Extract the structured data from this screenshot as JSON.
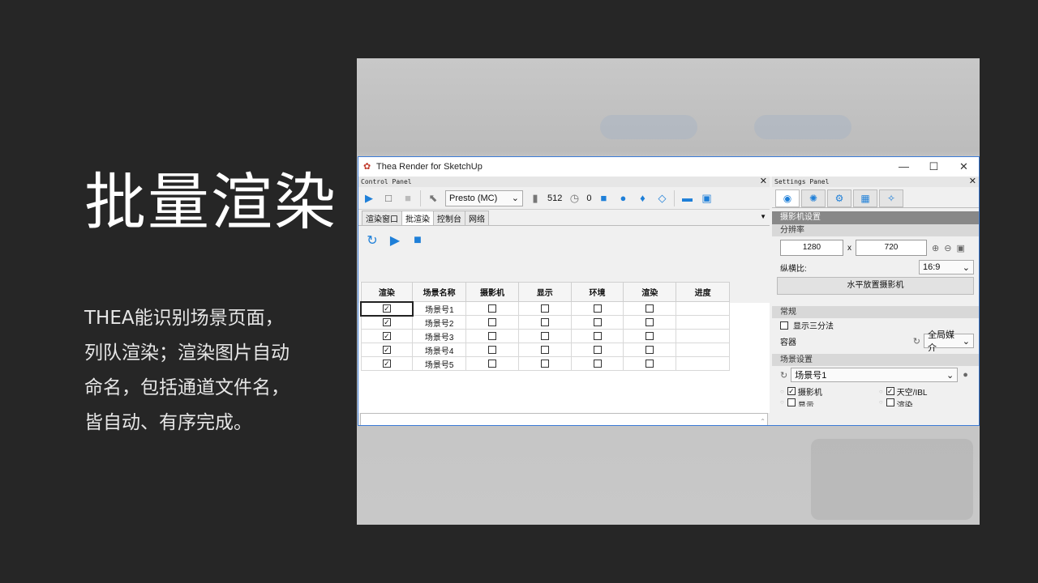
{
  "slide": {
    "title": "批量渲染",
    "lines": [
      "THEA能识别场景页面，",
      "列队渲染；渲染图片自动",
      "命名，包括通道文件名，",
      "皆自动、有序完成。"
    ]
  },
  "window": {
    "title": "Thea Render for SketchUp",
    "minimize": "—",
    "maximize": "☐",
    "close": "✕"
  },
  "control_panel": {
    "header": "Control Panel",
    "engine": "Presto (MC)",
    "samples": "512",
    "time": "0",
    "tabs": [
      "渲染窗口",
      "批渲染",
      "控制台",
      "网络"
    ],
    "table": {
      "headers": [
        "渲染",
        "场景名称",
        "摄影机",
        "显示",
        "环境",
        "渲染",
        "进度"
      ],
      "rows": [
        {
          "name": "场景号1",
          "render": true
        },
        {
          "name": "场景号2",
          "render": true
        },
        {
          "name": "场景号3",
          "render": true
        },
        {
          "name": "场景号4",
          "render": true
        },
        {
          "name": "场景号5",
          "render": true
        }
      ]
    }
  },
  "settings_panel": {
    "header": "Settings Panel",
    "camera_section": "摄影机设置",
    "resolution_label": "分辨率",
    "width": "1280",
    "x_sep": "x",
    "height": "720",
    "aspect_label": "纵横比:",
    "aspect_value": "16:9",
    "level_camera_button": "水平放置摄影机",
    "general_section": "常规",
    "thirds_label": "显示三分法",
    "container_label": "容器",
    "container_value": "全局媒介",
    "scene_section": "场景设置",
    "scene_value": "场景号1",
    "camera_check": "摄影机",
    "sky_check": "天空/IBL",
    "display_check": "显示",
    "render_check": "渲染"
  }
}
